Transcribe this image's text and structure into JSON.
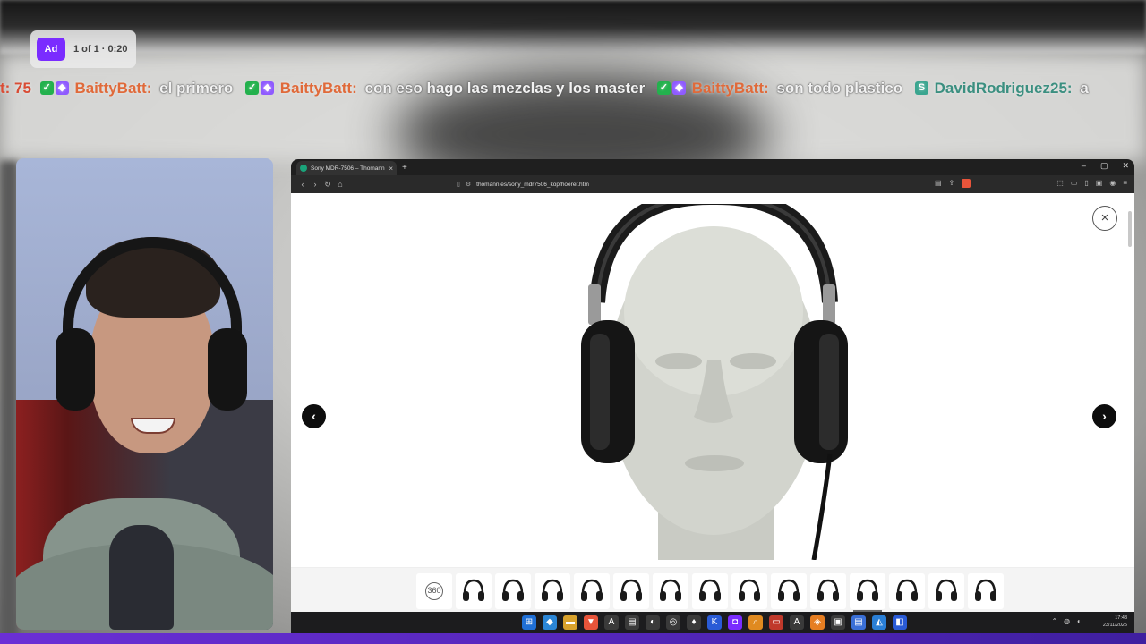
{
  "ad": {
    "badge": "Ad",
    "counter": "1 of 1 · 0:20"
  },
  "chat": {
    "lead_fragment": "t: 75",
    "messages": [
      {
        "user": "BaittyBatt:",
        "text": "el primero"
      },
      {
        "user": "BaittyBatt:",
        "text": "con eso hago las mezclas y los master"
      },
      {
        "user": "BaittyBatt:",
        "text": "son todo plastico"
      },
      {
        "user": "DavidRodriguez25:",
        "text": "a"
      }
    ]
  },
  "browser": {
    "tab_title": "Sony MDR-7506 – Thomann Es",
    "tab_close": "×",
    "new_tab": "+",
    "url": "thomann.es/sony_mdr7506_kopfhoerer.htm",
    "window_controls": [
      "–",
      "▢",
      "✕"
    ]
  },
  "viewer": {
    "close_label": "×",
    "prev_label": "‹",
    "next_label": "›",
    "thumbnails": [
      {
        "name": "thumb-360",
        "label": "360"
      },
      {
        "name": "thumb-headphones-front"
      },
      {
        "name": "thumb-headphones-angle"
      },
      {
        "name": "thumb-headphones-side"
      },
      {
        "name": "thumb-headphones-folded"
      },
      {
        "name": "thumb-headphones-back"
      },
      {
        "name": "thumb-earcup-closeup"
      },
      {
        "name": "thumb-earcup-angle"
      },
      {
        "name": "thumb-headphones-flat"
      },
      {
        "name": "thumb-headphones-case"
      },
      {
        "name": "thumb-mannequin-side"
      },
      {
        "name": "thumb-mannequin-front",
        "selected": true
      },
      {
        "name": "thumb-mannequin-back"
      },
      {
        "name": "thumb-jack-adapter"
      },
      {
        "name": "thumb-cable-plug"
      }
    ]
  },
  "taskbar": {
    "time": "17:43",
    "date": "23/11/2025"
  },
  "colors": {
    "accent": "#7a2cff",
    "chat_user": "#e06a3a",
    "chat_user_alt": "#3b8f80"
  }
}
